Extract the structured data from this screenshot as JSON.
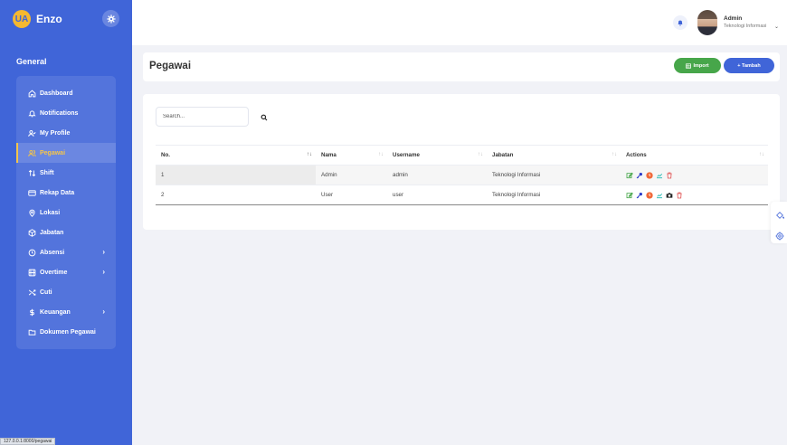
{
  "brand": {
    "name": "Enzo",
    "logo_text": "UA"
  },
  "colors": {
    "primary": "#4065d8",
    "accent": "#f5c54a",
    "success": "#47a64a",
    "danger": "#e05252",
    "warning": "#f0693a",
    "teal": "#1bb7b0"
  },
  "sidebar": {
    "section_title": "General",
    "items": [
      {
        "label": "Dashboard",
        "icon": "home-icon"
      },
      {
        "label": "Notifications",
        "icon": "bell-icon"
      },
      {
        "label": "My Profile",
        "icon": "user-check-icon"
      },
      {
        "label": "Pegawai",
        "icon": "users-icon",
        "active": true
      },
      {
        "label": "Shift",
        "icon": "swap-icon"
      },
      {
        "label": "Rekap Data",
        "icon": "card-icon"
      },
      {
        "label": "Lokasi",
        "icon": "map-pin-icon"
      },
      {
        "label": "Jabatan",
        "icon": "box-icon"
      },
      {
        "label": "Absensi",
        "icon": "clock-icon",
        "has_submenu": true
      },
      {
        "label": "Overtime",
        "icon": "film-icon",
        "has_submenu": true
      },
      {
        "label": "Cuti",
        "icon": "shuffle-icon"
      },
      {
        "label": "Keuangan",
        "icon": "dollar-icon",
        "has_submenu": true
      },
      {
        "label": "Dokumen Pegawai",
        "icon": "folder-icon"
      }
    ]
  },
  "topbar": {
    "user_name": "Admin",
    "user_role": "Teknologi Informasi"
  },
  "page": {
    "title": "Pegawai",
    "import_label": "Import",
    "add_label": "+ Tambah"
  },
  "search": {
    "placeholder": "Search..."
  },
  "table": {
    "columns": [
      "No.",
      "Nama",
      "Username",
      "Jabatan",
      "Actions"
    ],
    "rows": [
      {
        "no": "1",
        "nama": "Admin",
        "username": "admin",
        "jabatan": "Teknologi Informasi"
      },
      {
        "no": "2",
        "nama": "User",
        "username": "user",
        "jabatan": "Teknologi Informasi"
      }
    ]
  },
  "status_url": "127.0.0.1:8000/pegawai"
}
